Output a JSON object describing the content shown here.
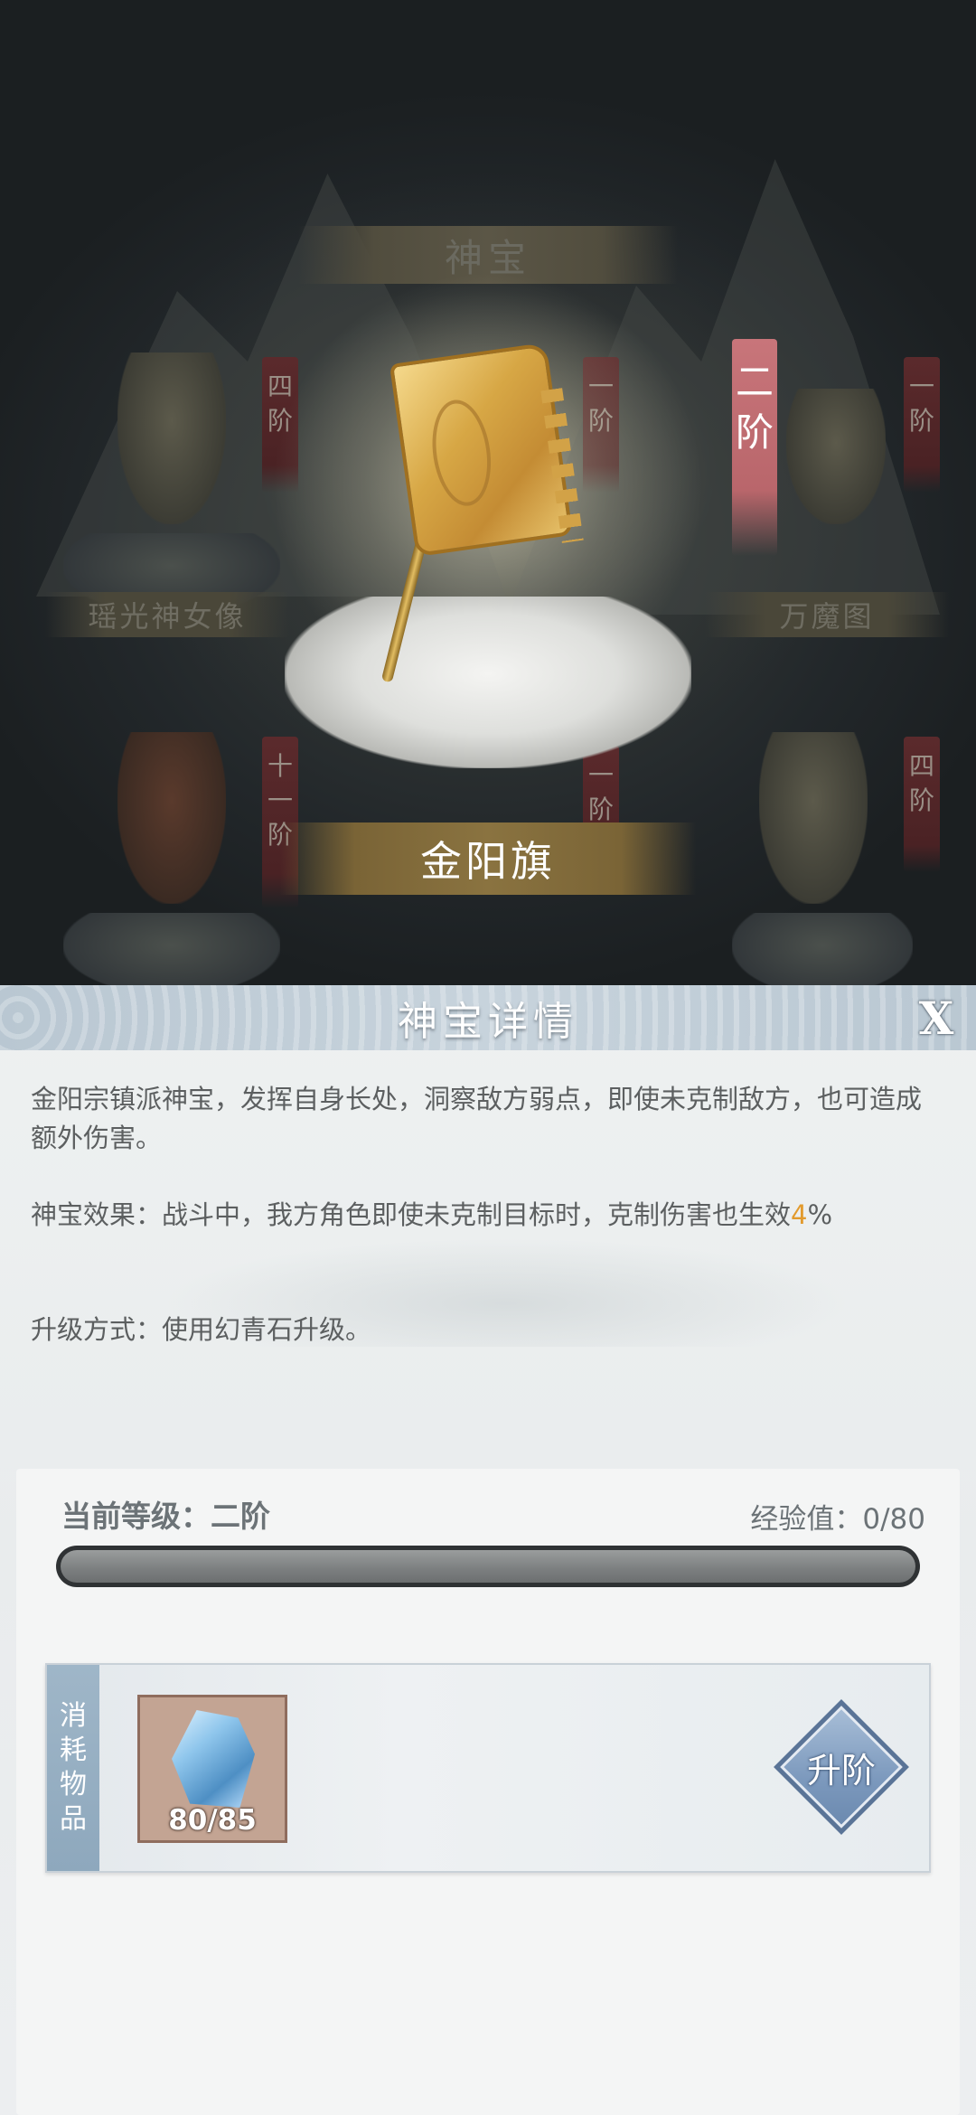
{
  "scene": {
    "header_title": "神宝",
    "items": [
      {
        "name": "瑶光神女像",
        "tier": [
          "四",
          "阶"
        ]
      },
      {
        "name": "",
        "tier": [
          "一",
          "阶"
        ]
      },
      {
        "name": "万魔图",
        "tier": [
          "一",
          "阶"
        ]
      },
      {
        "name": "",
        "tier": [
          "十",
          "一",
          "阶"
        ]
      },
      {
        "name": "",
        "tier": [
          "一",
          "阶"
        ]
      },
      {
        "name": "",
        "tier": [
          "四",
          "阶"
        ]
      }
    ],
    "featured": {
      "name": "金阳旗",
      "tier": [
        "二",
        "阶"
      ]
    }
  },
  "panel": {
    "title": "神宝详情",
    "close_label": "X",
    "description": "金阳宗镇派神宝，发挥自身长处，洞察敌方弱点，即使未克制敌方，也可造成额外伤害。",
    "effect_prefix": "神宝效果：战斗中，我方角色即使未克制目标时，克制伤害也生效",
    "effect_value": "4",
    "effect_suffix": "%",
    "upgrade_method": "升级方式：使用幻青石升级。",
    "level_label": "当前等级：二阶",
    "exp_label": "经验值：0/80",
    "exp_progress": 0,
    "consume_tab": [
      "消",
      "耗",
      "物",
      "品"
    ],
    "material": {
      "icon": "crystal-icon",
      "count": "80/85"
    },
    "upgrade_button": "升阶"
  },
  "colors": {
    "accent": "#e29a2d",
    "tier_active": "#c8757a",
    "panel_header": "#c0ccd6"
  }
}
